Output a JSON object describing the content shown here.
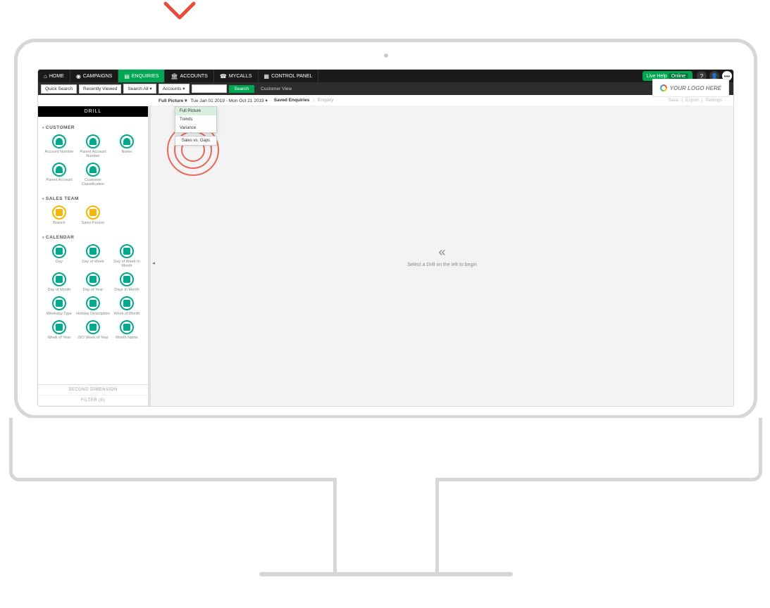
{
  "nav": {
    "home": "HOME",
    "campaigns": "CAMPAIGNS",
    "enquiries": "ENQUIRIES",
    "accounts": "ACCOUNTS",
    "mycalls": "MYCALLS",
    "control_panel": "CONTROL PANEL",
    "live_help": "Live Help",
    "live_help_status": "Online"
  },
  "toolbar": {
    "quick_search": "Quick Search",
    "recently_viewed": "Recently Viewed",
    "search_all": "Search All",
    "accounts": "Accounts",
    "search": "Search",
    "customer_view": "Customer View"
  },
  "logo": "YOUR LOGO HERE",
  "crumb": {
    "view": "Full Picture",
    "date_range": "Tue Jan 01 2019 - Mon Oct 21 2019",
    "saved": "Saved Enquiries",
    "current": "Enquiry",
    "save": "Save",
    "export": "Export",
    "settings": "Settings"
  },
  "dropdown": {
    "opt1": "Full Picture",
    "opt2": "Trends",
    "opt3": "Variance",
    "sub": "Sales vs. Gaps"
  },
  "sidebar": {
    "drill": "DRILL",
    "customer": "CUSTOMER",
    "customer_items": [
      "Account Number",
      "Parent Account Number",
      "Name",
      "Parent Account",
      "Customer Classification"
    ],
    "sales_team": "SALES TEAM",
    "sales_items": [
      "Branch",
      "Sales Person"
    ],
    "calendar": "CALENDAR",
    "calendar_items": [
      "Day",
      "Day of Week",
      "Day of Week In Month",
      "Day of Month",
      "Day of Year",
      "Days In Month",
      "Weekday Type",
      "Holiday Description",
      "Week of Month",
      "Week of Year",
      "ISO Week of Year",
      "Month Name"
    ],
    "second_dim": "SECOND DIMENSION",
    "filter": "FILTER (0)"
  },
  "content": {
    "empty": "Select a Drill on the left to begin"
  }
}
